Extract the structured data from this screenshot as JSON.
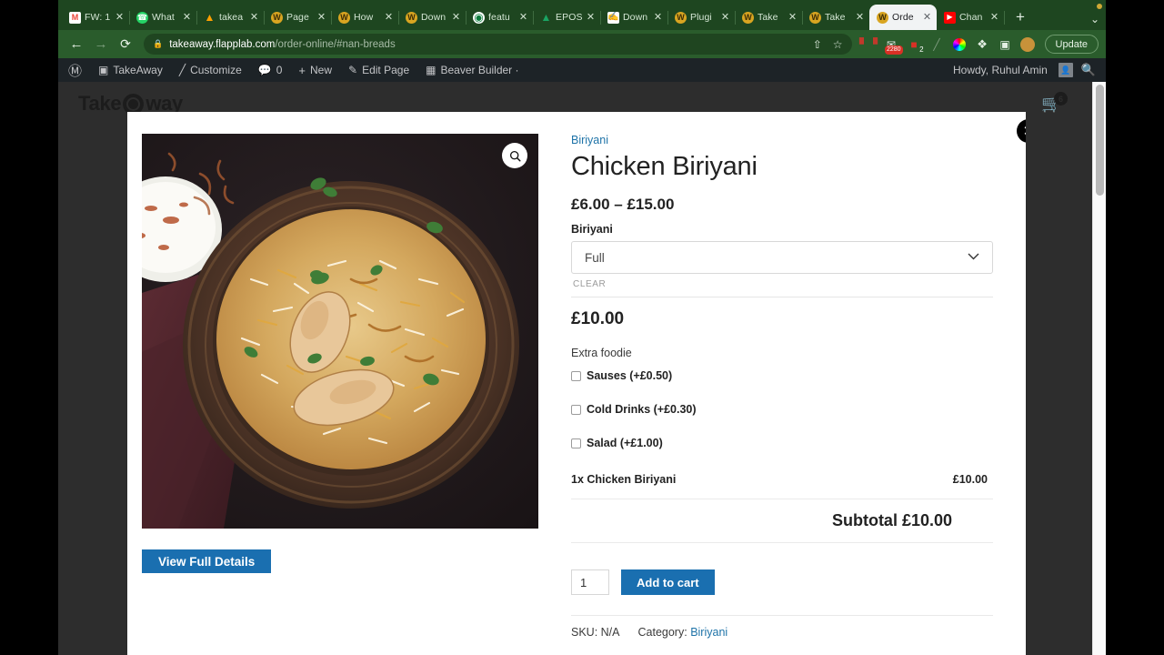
{
  "browser": {
    "tabs": [
      {
        "title": "FW: 1",
        "favicon": "gmail-icon",
        "active": false
      },
      {
        "title": "What",
        "favicon": "whatsapp-icon",
        "active": false
      },
      {
        "title": "takea",
        "favicon": "firebase-icon",
        "active": false
      },
      {
        "title": "Page",
        "favicon": "wordpress-gold-icon",
        "active": false
      },
      {
        "title": "How",
        "favicon": "wordpress-gold-icon",
        "active": false
      },
      {
        "title": "Down",
        "favicon": "wordpress-gold-icon",
        "active": false
      },
      {
        "title": "featu",
        "favicon": "globe-icon",
        "active": false
      },
      {
        "title": "EPOS",
        "favicon": "drive-icon",
        "active": false
      },
      {
        "title": "Down",
        "favicon": "file-icon",
        "active": false
      },
      {
        "title": "Plugi",
        "favicon": "wordpress-gold-icon",
        "active": false
      },
      {
        "title": "Take",
        "favicon": "wordpress-gold-icon",
        "active": false
      },
      {
        "title": "Take",
        "favicon": "wordpress-gold-icon",
        "active": false
      },
      {
        "title": "Orde",
        "favicon": "wordpress-gold-icon",
        "active": true
      },
      {
        "title": "Chan",
        "favicon": "youtube-icon",
        "active": false
      }
    ],
    "newtab_label": "+",
    "tablist_chevron": "⌄",
    "nav": {
      "back": "←",
      "forward": "→",
      "reload": "⟳",
      "lock_icon": "lock-icon",
      "url_domain": "takeaway.flapplab.com",
      "url_path": "/order-online/#nan-breads",
      "share_icon": "⇧",
      "bookmark_icon": "☆"
    },
    "extensions": [
      {
        "name": "bitwarden-icon",
        "badge": ""
      },
      {
        "name": "mail-checker-icon",
        "badge": "2280"
      },
      {
        "name": "notification-icon",
        "badge": "2"
      },
      {
        "name": "pen-icon",
        "badge": ""
      },
      {
        "name": "colorpicker-icon",
        "badge": ""
      },
      {
        "name": "puzzle-icon",
        "badge": ""
      },
      {
        "name": "sidepanel-icon",
        "badge": ""
      }
    ],
    "profile_icon": "avatar-icon",
    "update_label": "Update"
  },
  "wpbar": {
    "logo": "wordpress-icon",
    "items": [
      {
        "label": "TakeAway",
        "icon": "dashboard-icon"
      },
      {
        "label": "Customize",
        "icon": "brush-icon"
      },
      {
        "label": "0",
        "icon": "comment-icon"
      },
      {
        "label": "New",
        "icon": "plus-icon"
      },
      {
        "label": "Edit Page",
        "icon": "pencil-icon"
      },
      {
        "label": "Beaver Builder ·",
        "icon": "grid-icon"
      }
    ],
    "greeting": "Howdy, Ruhul Amin",
    "search_icon": "search-icon"
  },
  "site": {
    "logo_text": "Take",
    "logo_text_end": "way",
    "cart_count": "6",
    "cart_icon": "cart-icon"
  },
  "modal": {
    "close_icon": "✕",
    "zoom_icon": "search-icon",
    "image_alt": "chicken-biriyani-photo",
    "view_details_label": "View Full Details",
    "breadcrumb": "Biriyani",
    "title": "Chicken Biriyani",
    "price_range": "£6.00 – £15.00",
    "attribute_label": "Biriyani",
    "selected_option": "Full",
    "select_chevron": "⌄",
    "clear_label": "CLEAR",
    "unit_price": "£10.00",
    "extras_label": "Extra foodie",
    "extras": [
      {
        "label": "Sauses (+£0.50)",
        "checked": false
      },
      {
        "label": "Cold Drinks (+£0.30)",
        "checked": false
      },
      {
        "label": "Salad (+£1.00)",
        "checked": false
      }
    ],
    "summary_item": "1x Chicken Biriyani",
    "summary_item_price": "£10.00",
    "subtotal": "Subtotal £10.00",
    "quantity": "1",
    "add_to_cart_label": "Add to cart",
    "sku": "SKU: N/A",
    "category_label": "Category:",
    "category_value": "Biriyani"
  },
  "colors": {
    "browser_chrome": "#2a5c2c",
    "tabstrip": "#1e4620",
    "wpbar": "#1d2327",
    "page_bg": "#2d2d2d",
    "accent_blue": "#1a6fb0",
    "link_blue": "#1e73a8"
  }
}
